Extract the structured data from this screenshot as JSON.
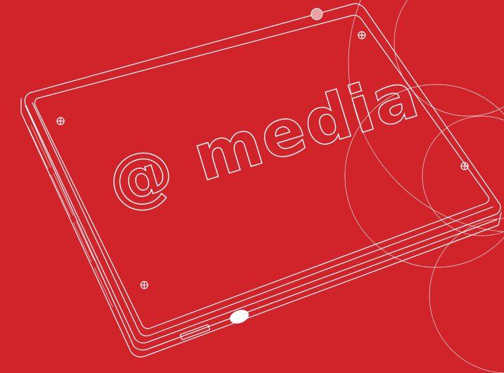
{
  "illustration": {
    "logo_text": "@ media",
    "background_color": "#d0232a",
    "line_color": "#ffffff",
    "device": "media-box",
    "icons": [
      "screw-icon",
      "power-button-icon",
      "usb-port-icon",
      "led-icon"
    ]
  }
}
